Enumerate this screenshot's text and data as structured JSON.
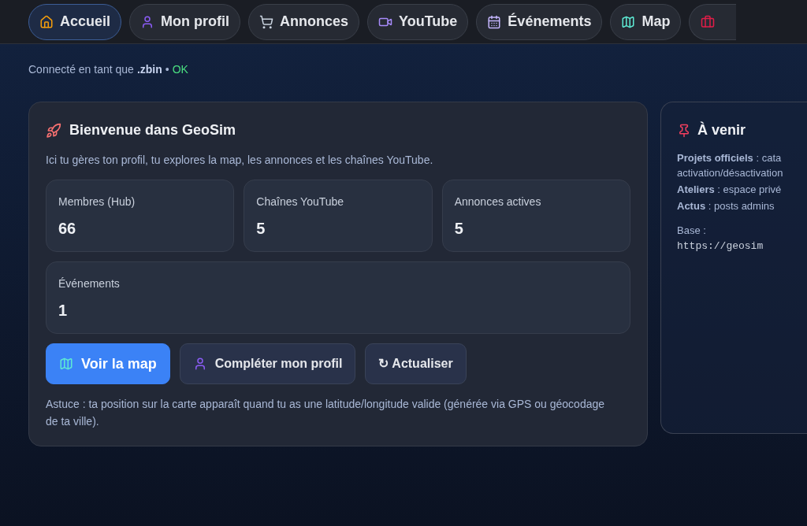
{
  "tabs": [
    {
      "label": "Accueil",
      "selected": true
    },
    {
      "label": "Mon profil",
      "selected": false
    },
    {
      "label": "Annonces",
      "selected": false
    },
    {
      "label": "YouTube",
      "selected": false
    },
    {
      "label": "Événements",
      "selected": false
    },
    {
      "label": "Map",
      "selected": false
    }
  ],
  "status": {
    "prefix": "Connecté en tant que",
    "user": ".zbin",
    "separator": "•",
    "state": "OK"
  },
  "welcome": {
    "title": "Bienvenue dans GeoSim",
    "intro": "Ici tu gères ton profil, tu explores la map, les annonces et les chaînes YouTube.",
    "stats": [
      {
        "label": "Membres (Hub)",
        "value": "66"
      },
      {
        "label": "Chaînes YouTube",
        "value": "5"
      },
      {
        "label": "Annonces actives",
        "value": "5"
      },
      {
        "label": "Événements",
        "value": "1"
      }
    ],
    "buttons": [
      {
        "label": "Voir la map",
        "kind": "primary"
      },
      {
        "label": "Compléter mon profil",
        "kind": "secondary"
      },
      {
        "label": "↻ Actualiser",
        "kind": "secondary"
      }
    ],
    "tip": "Astuce : ta position sur la carte apparaît quand tu as une latitude/longitude valide (générée via GPS ou géocodage de ta ville)."
  },
  "upcoming": {
    "title": "À venir",
    "items": [
      "**Projets officiels** : cata activation/désactivation",
      "**Ateliers** : espace privé",
      "**Actus** : posts admins"
    ],
    "base_label": "Base :",
    "base_url": "https://geosim"
  }
}
